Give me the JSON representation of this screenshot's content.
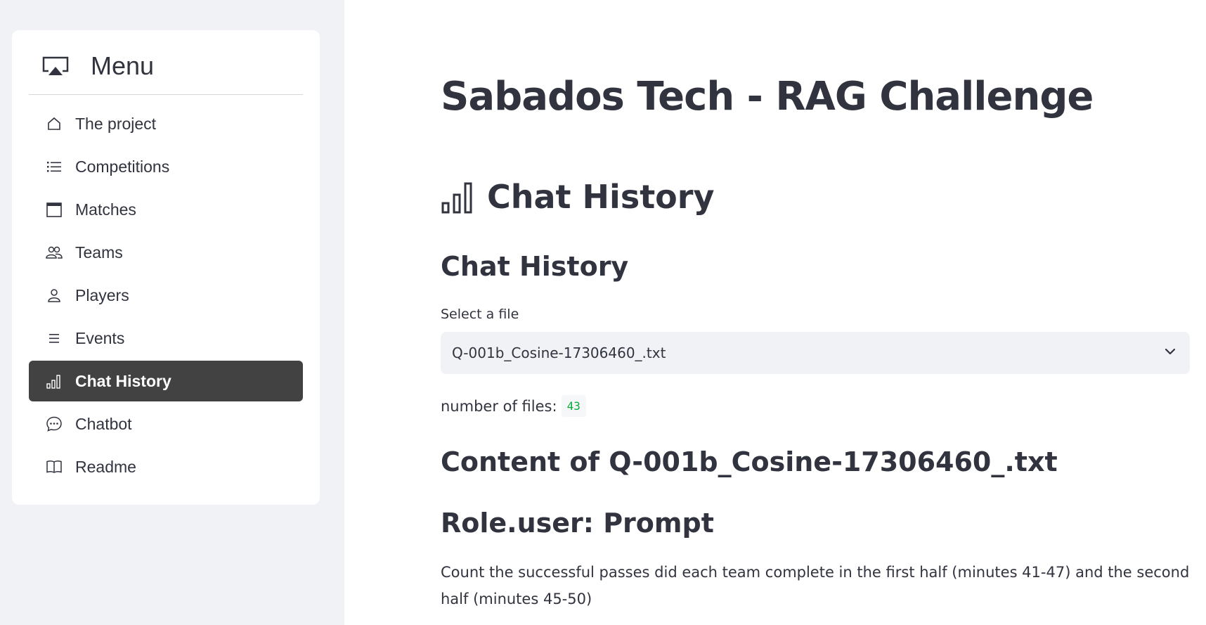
{
  "sidebar": {
    "menu_title": "Menu",
    "menu_icon": "airplay-icon",
    "items": [
      {
        "label": "The project",
        "icon": "house-icon",
        "active": false
      },
      {
        "label": "Competitions",
        "icon": "list-icon",
        "active": false
      },
      {
        "label": "Matches",
        "icon": "calendar-icon",
        "active": false
      },
      {
        "label": "Teams",
        "icon": "people-icon",
        "active": false
      },
      {
        "label": "Players",
        "icon": "person-icon",
        "active": false
      },
      {
        "label": "Events",
        "icon": "lines-icon",
        "active": false
      },
      {
        "label": "Chat History",
        "icon": "bar-chart-icon",
        "active": true
      },
      {
        "label": "Chatbot",
        "icon": "chat-dots-icon",
        "active": false
      },
      {
        "label": "Readme",
        "icon": "book-icon",
        "active": false
      }
    ]
  },
  "main": {
    "title": "Sabados Tech - RAG Challenge",
    "page_heading": "Chat History",
    "section_heading": "Chat History",
    "select": {
      "label": "Select a file",
      "value": "Q-001b_Cosine-17306460_.txt"
    },
    "file_count": {
      "label": "number of files:",
      "value": "43"
    },
    "content_heading": "Content of Q-001b_Cosine-17306460_.txt",
    "role_heading": "Role.user: Prompt",
    "prompt_text": "Count the successful passes did each team complete in the first half (minutes 41-47) and the second half (minutes 45-50)"
  },
  "colors": {
    "sidebar_bg": "#f0f2f6",
    "active_item_bg": "#424242",
    "text": "#31333f",
    "badge_text": "#09ab3b"
  }
}
